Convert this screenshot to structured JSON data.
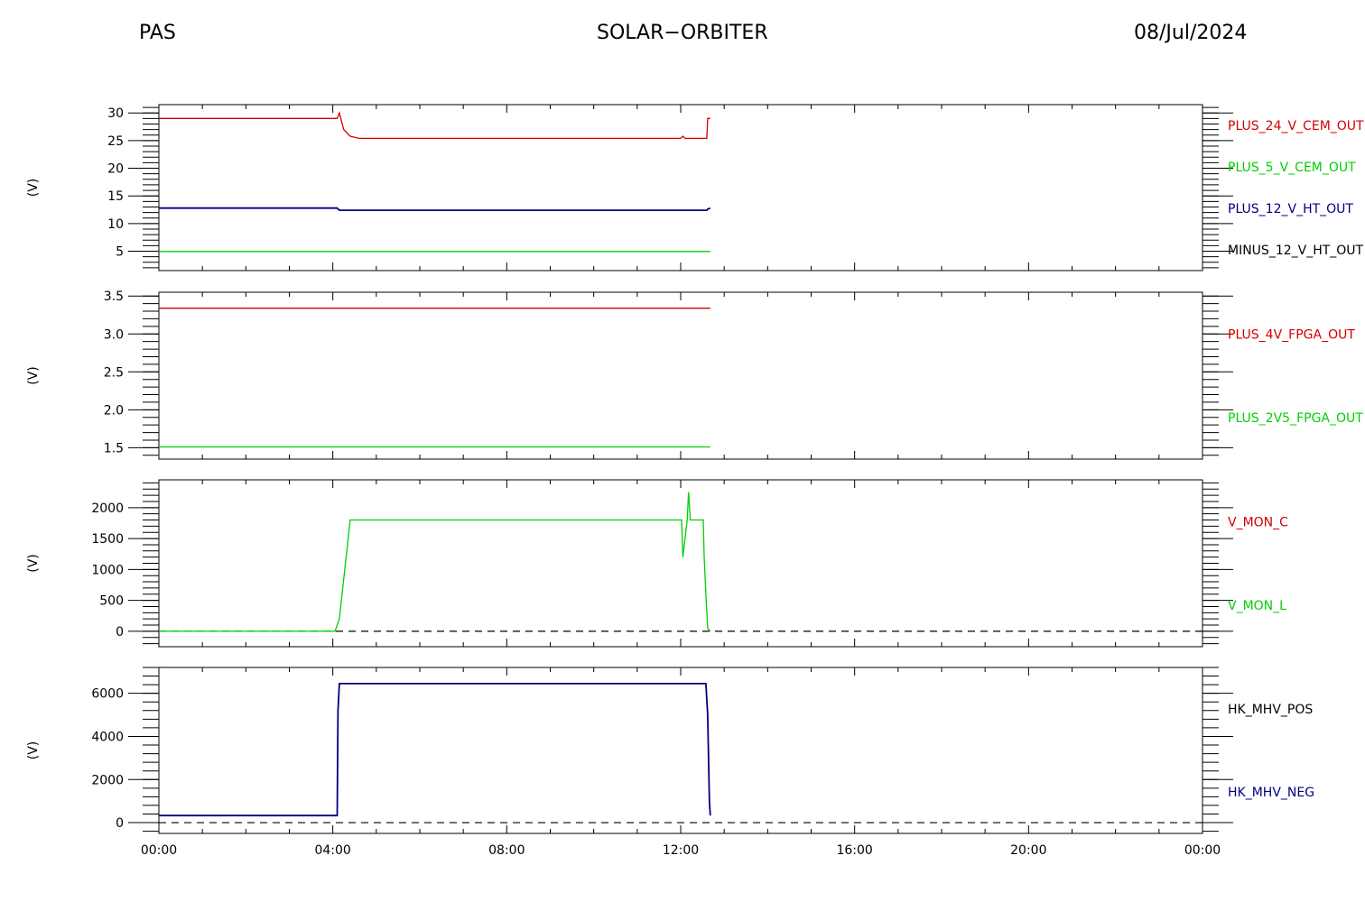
{
  "header": {
    "left": "PAS",
    "center": "SOLAR−ORBITER",
    "right": "08/Jul/2024"
  },
  "colors": {
    "red": "#d40000",
    "green": "#00d000",
    "navy": "#000080",
    "black": "#000000"
  },
  "chart_data": [
    {
      "type": "line",
      "ylabel": "(V)",
      "ylim": [
        1.5,
        31.5
      ],
      "yticks": [
        5,
        10,
        15,
        20,
        25,
        30
      ],
      "xlim": [
        0,
        24
      ],
      "xticks": [
        "00:00",
        "04:00",
        "08:00",
        "12:00",
        "16:00",
        "20:00",
        "00:00"
      ],
      "series": [
        {
          "name": "PLUS_24_V_CEM_OUT",
          "color": "#d40000",
          "x": [
            0,
            4.1,
            4.15,
            4.25,
            4.4,
            4.6,
            12.0,
            12.05,
            12.1,
            12.6,
            12.62,
            12.68
          ],
          "y": [
            29.0,
            29.0,
            30.0,
            27.0,
            25.8,
            25.4,
            25.4,
            25.8,
            25.4,
            25.4,
            29.0,
            29.0
          ]
        },
        {
          "name": "PLUS_5_V_CEM_OUT",
          "color": "#00d000",
          "x": [],
          "y": []
        },
        {
          "name": "PLUS_12_V_HT_OUT",
          "color": "#000080",
          "x": [
            0,
            4.1,
            4.15,
            12.6,
            12.62,
            12.68
          ],
          "y": [
            12.8,
            12.8,
            12.4,
            12.4,
            12.6,
            12.8
          ]
        },
        {
          "name": "MINUS_12_V_HT_OUT",
          "color": "#000000",
          "x": [],
          "y": []
        },
        {
          "name": "",
          "color": "#00d000",
          "x": [
            0,
            12.68
          ],
          "y": [
            4.95,
            4.95
          ]
        }
      ]
    },
    {
      "type": "line",
      "ylabel": "(V)",
      "ylim": [
        1.35,
        3.55
      ],
      "yticks": [
        1.5,
        2.0,
        2.5,
        3.0,
        3.5
      ],
      "xlim": [
        0,
        24
      ],
      "series": [
        {
          "name": "PLUS_4V_FPGA_OUT",
          "color": "#d40000",
          "x": [
            0,
            12.68
          ],
          "y": [
            3.34,
            3.34
          ]
        },
        {
          "name": "PLUS_2V5_FPGA_OUT",
          "color": "#00d000",
          "x": [
            0,
            12.68
          ],
          "y": [
            1.51,
            1.51
          ]
        }
      ]
    },
    {
      "type": "line",
      "ylabel": "(V)",
      "ylim": [
        -250,
        2450
      ],
      "yticks": [
        0,
        500,
        1000,
        1500,
        2000
      ],
      "xlim": [
        0,
        24
      ],
      "zero_line": true,
      "series": [
        {
          "name": "V_MON_C",
          "color": "#d40000",
          "x": [],
          "y": []
        },
        {
          "name": "V_MON_L",
          "color": "#00d000",
          "x": [
            0,
            4.05,
            4.15,
            4.4,
            12.02,
            12.05,
            12.15,
            12.18,
            12.22,
            12.52,
            12.54,
            12.58,
            12.62,
            12.68
          ],
          "y": [
            0,
            0,
            200,
            1800,
            1800,
            1200,
            1800,
            2250,
            1800,
            1800,
            1200,
            600,
            50,
            0
          ]
        }
      ]
    },
    {
      "type": "line",
      "ylabel": "(V)",
      "ylim": [
        -500,
        7200
      ],
      "yticks": [
        0,
        2000,
        4000,
        6000
      ],
      "xlim": [
        0,
        24
      ],
      "zero_line": true,
      "series": [
        {
          "name": "HK_MHV_POS",
          "color": "#000000",
          "x": [],
          "y": []
        },
        {
          "name": "HK_MHV_NEG",
          "color": "#000080",
          "x": [
            0,
            4.1,
            4.12,
            4.15,
            12.58,
            12.62,
            12.66,
            12.68
          ],
          "y": [
            330,
            330,
            5200,
            6450,
            6450,
            5000,
            1000,
            330
          ]
        }
      ]
    }
  ]
}
